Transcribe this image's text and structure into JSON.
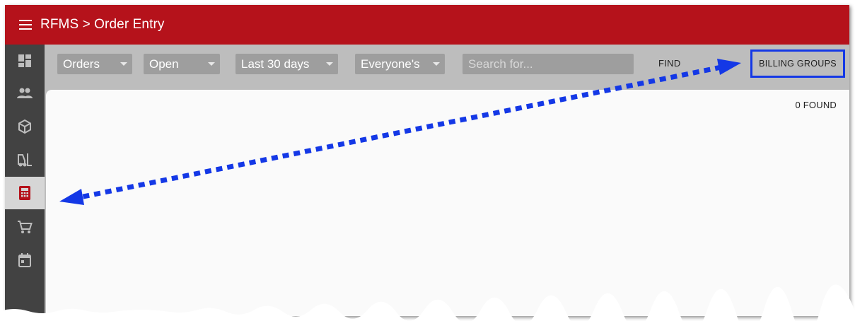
{
  "header": {
    "title": "RFMS > Order Entry",
    "bar_color": "#b5121b",
    "menu_icon": "hamburger-menu-icon"
  },
  "sidebar": {
    "items": [
      {
        "icon": "dashboard-icon",
        "active": false
      },
      {
        "icon": "people-icon",
        "active": false
      },
      {
        "icon": "package-icon",
        "active": false
      },
      {
        "icon": "forklift-icon",
        "active": false
      },
      {
        "icon": "calculator-icon",
        "active": true
      },
      {
        "icon": "shopping-cart-icon",
        "active": false
      },
      {
        "icon": "calendar-icon",
        "active": false
      }
    ],
    "active_icon_color": "#b5121b"
  },
  "toolbar": {
    "filters": [
      {
        "value": "Orders"
      },
      {
        "value": "Open"
      },
      {
        "value": "Last 30 days"
      },
      {
        "value": "Everyone's"
      }
    ],
    "search_placeholder": "Search for...",
    "search_value": "",
    "find_label": "FIND",
    "billing_groups_label": "BILLING GROUPS"
  },
  "results": {
    "found_label": "0 FOUND"
  },
  "annotation": {
    "highlight_color": "#1438e6",
    "arrow_style": "dotted double-headed arrow"
  }
}
